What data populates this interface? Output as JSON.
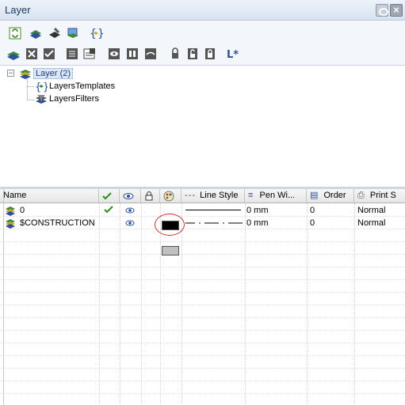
{
  "window": {
    "title": "Layer"
  },
  "tree": {
    "root_label": "Layer (2)",
    "children": [
      "LayersTemplates",
      "LayersFilters"
    ]
  },
  "columns": {
    "name": "Name",
    "line_style": "Line Style",
    "pen_width": "Pen Wi...",
    "order": "Order",
    "print": "Print S"
  },
  "rows": [
    {
      "name": "0",
      "visible_check": true,
      "color": "#000000",
      "line_type": "solid",
      "pen_width": "0 mm",
      "order": "0",
      "print_style": "Normal"
    },
    {
      "name": "$CONSTRUCTION",
      "visible_check": false,
      "color": "#c0c0c0",
      "line_type": "dash-dot",
      "pen_width": "0 mm",
      "order": "0",
      "print_style": "Normal"
    }
  ],
  "icons": {
    "toolbar1": [
      "refresh-icon",
      "layer-new-icon",
      "layer-edit-icon",
      "layer-copy-icon",
      "template-icon"
    ],
    "toolbar2": [
      "layer-zoom-icon",
      "delete-icon",
      "check-icon",
      "move-icon",
      "properties-icon",
      "eye-icon",
      "freeze-icon",
      "hide-icon",
      "lock-icon",
      "unlock-icon",
      "lock-all-icon",
      "layer-prefix-icon"
    ]
  },
  "colors": {
    "accent": "#1c3f82",
    "highlight": "#dbe7f7",
    "annotation": "#d23030"
  }
}
